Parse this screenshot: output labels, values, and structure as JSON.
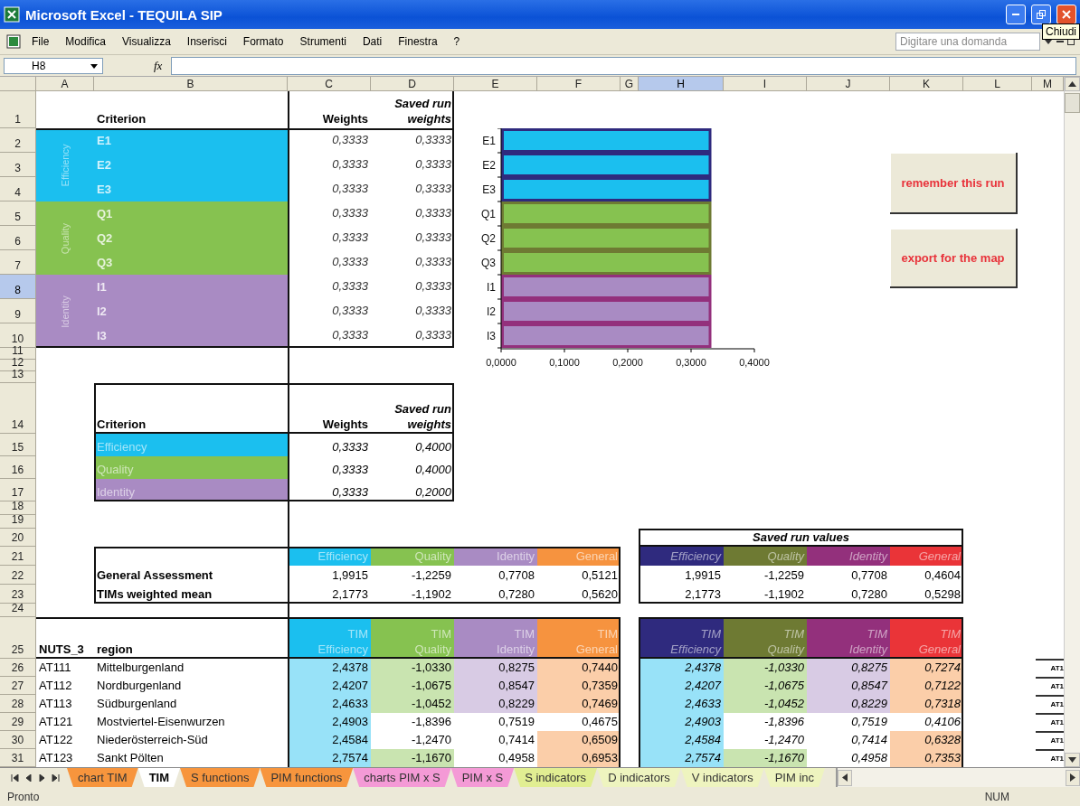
{
  "window": {
    "title": "Microsoft Excel - TEQUILA SIP",
    "tooltip": "Chiudi"
  },
  "menu": {
    "items": [
      "File",
      "Modifica",
      "Visualizza",
      "Inserisci",
      "Formato",
      "Strumenti",
      "Dati",
      "Finestra",
      "?"
    ],
    "help_placeholder": "Digitare una domanda"
  },
  "formula_bar": {
    "name_box": "H8",
    "function_label": "fx"
  },
  "columns": [
    {
      "label": "A",
      "selected": false
    },
    {
      "label": "B",
      "selected": false
    },
    {
      "label": "C",
      "selected": false
    },
    {
      "label": "D",
      "selected": false
    },
    {
      "label": "E",
      "selected": false
    },
    {
      "label": "F",
      "selected": false
    },
    {
      "label": "G",
      "selected": false
    },
    {
      "label": "H",
      "selected": true
    },
    {
      "label": "I",
      "selected": false
    },
    {
      "label": "J",
      "selected": false
    },
    {
      "label": "K",
      "selected": false
    },
    {
      "label": "L",
      "selected": false
    },
    {
      "label": "M",
      "selected": false
    }
  ],
  "rows": [
    {
      "label": "1",
      "selected": false
    },
    {
      "label": "2",
      "selected": false
    },
    {
      "label": "3",
      "selected": false
    },
    {
      "label": "4",
      "selected": false
    },
    {
      "label": "5",
      "selected": false
    },
    {
      "label": "6",
      "selected": false
    },
    {
      "label": "7",
      "selected": false
    },
    {
      "label": "8",
      "selected": true
    },
    {
      "label": "9",
      "selected": false
    },
    {
      "label": "10",
      "selected": false
    },
    {
      "label": "11",
      "selected": false
    },
    {
      "label": "12",
      "selected": false
    },
    {
      "label": "13",
      "selected": false
    },
    {
      "label": "14",
      "selected": false
    },
    {
      "label": "15",
      "selected": false
    },
    {
      "label": "16",
      "selected": false
    },
    {
      "label": "17",
      "selected": false
    },
    {
      "label": "18",
      "selected": false
    },
    {
      "label": "19",
      "selected": false
    },
    {
      "label": "20",
      "selected": false
    },
    {
      "label": "21",
      "selected": false
    },
    {
      "label": "22",
      "selected": false
    },
    {
      "label": "23",
      "selected": false
    },
    {
      "label": "24",
      "selected": false
    },
    {
      "label": "25",
      "selected": false
    },
    {
      "label": "26",
      "selected": false
    },
    {
      "label": "27",
      "selected": false
    },
    {
      "label": "28",
      "selected": false
    },
    {
      "label": "29",
      "selected": false
    },
    {
      "label": "30",
      "selected": false
    },
    {
      "label": "31",
      "selected": false
    }
  ],
  "criteria_table": {
    "headers": {
      "criterion": "Criterion",
      "weights": "Weights",
      "saved": "Saved run weights"
    },
    "groups": [
      {
        "name": "Efficiency",
        "color": "#1bbfef",
        "items": [
          {
            "label": "E1",
            "weight": "0,3333",
            "saved": "0,3333"
          },
          {
            "label": "E2",
            "weight": "0,3333",
            "saved": "0,3333"
          },
          {
            "label": "E3",
            "weight": "0,3333",
            "saved": "0,3333"
          }
        ]
      },
      {
        "name": "Quality",
        "color": "#86c250",
        "items": [
          {
            "label": "Q1",
            "weight": "0,3333",
            "saved": "0,3333"
          },
          {
            "label": "Q2",
            "weight": "0,3333",
            "saved": "0,3333"
          },
          {
            "label": "Q3",
            "weight": "0,3333",
            "saved": "0,3333"
          }
        ]
      },
      {
        "name": "Identity",
        "color": "#a98bc3",
        "items": [
          {
            "label": "I1",
            "weight": "0,3333",
            "saved": "0,3333"
          },
          {
            "label": "I2",
            "weight": "0,3333",
            "saved": "0,3333"
          },
          {
            "label": "I3",
            "weight": "0,3333",
            "saved": "0,3333"
          }
        ]
      }
    ]
  },
  "chart_data": {
    "type": "bar",
    "orientation": "horizontal",
    "categories": [
      "E1",
      "E2",
      "E3",
      "Q1",
      "Q2",
      "Q3",
      "I1",
      "I2",
      "I3"
    ],
    "values": [
      0.33,
      0.33,
      0.33,
      0.33,
      0.33,
      0.33,
      0.33,
      0.33,
      0.33
    ],
    "xlim": [
      0,
      0.4
    ],
    "xticks": [
      {
        "value": 0,
        "label": "0,0000"
      },
      {
        "value": 0.1,
        "label": "0,1000"
      },
      {
        "value": 0.2,
        "label": "0,2000"
      },
      {
        "value": 0.3,
        "label": "0,3000"
      },
      {
        "value": 0.4,
        "label": "0,4000"
      }
    ]
  },
  "buttons": [
    "remember this run",
    "export for the map"
  ],
  "summary_table": {
    "headers": {
      "criterion": "Criterion",
      "weights": "Weights",
      "saved": "Saved run weights"
    },
    "items": [
      {
        "label": "Efficiency",
        "color": "#1bbfef",
        "weight": "0,3333",
        "saved": "0,4000"
      },
      {
        "label": "Quality",
        "color": "#86c250",
        "weight": "0,3333",
        "saved": "0,4000"
      },
      {
        "label": "Identity",
        "color": "#a98bc3",
        "weight": "0,3333",
        "saved": "0,2000"
      }
    ]
  },
  "assessment": {
    "columns": [
      {
        "label": "Efficiency",
        "color": "#1bbfef"
      },
      {
        "label": "Quality",
        "color": "#86c250"
      },
      {
        "label": "Identity",
        "color": "#a98bc3"
      },
      {
        "label": "General",
        "color": "#f6933f"
      }
    ],
    "rows": [
      {
        "label": "General Assessment",
        "values": [
          "1,9915",
          "-1,2259",
          "0,7708",
          "0,5121"
        ]
      },
      {
        "label": "TIMs weighted mean",
        "values": [
          "2,1773",
          "-1,1902",
          "0,7280",
          "0,5620"
        ]
      }
    ]
  },
  "saved_values": {
    "title": "Saved run values",
    "columns": [
      {
        "label": "Efficiency",
        "color": "#2f2a7e"
      },
      {
        "label": "Quality",
        "color": "#6e7a33"
      },
      {
        "label": "Identity",
        "color": "#93307c"
      },
      {
        "label": "General",
        "color": "#ea3438"
      }
    ],
    "rows": [
      [
        "1,9915",
        "-1,2259",
        "0,7708",
        "0,4604"
      ],
      [
        "2,1773",
        "-1,1902",
        "0,7280",
        "0,5298"
      ]
    ]
  },
  "regions": {
    "code_header": "NUTS_3",
    "name_header": "region",
    "columns": [
      {
        "top": "TIM",
        "bottom": "Efficiency",
        "color": "#1bbfef"
      },
      {
        "top": "TIM",
        "bottom": "Quality",
        "color": "#86c250"
      },
      {
        "top": "TIM",
        "bottom": "Identity",
        "color": "#a98bc3"
      },
      {
        "top": "TIM",
        "bottom": "General",
        "color": "#f6933f"
      }
    ],
    "saved_columns": [
      {
        "top": "TIM",
        "bottom": "Efficiency",
        "color": "#2f2a7e"
      },
      {
        "top": "TIM",
        "bottom": "Quality",
        "color": "#6e7a33"
      },
      {
        "top": "TIM",
        "bottom": "Identity",
        "color": "#93307c"
      },
      {
        "top": "TIM",
        "bottom": "General",
        "color": "#ea3438"
      }
    ],
    "rows": [
      {
        "code": "AT111",
        "name": "Mittelburgenland",
        "values": [
          {
            "text": "2,4378",
            "shaded": true
          },
          {
            "text": "-1,0330",
            "shaded": true
          },
          {
            "text": "0,8275",
            "shaded": true
          },
          {
            "text": "0,7440",
            "shaded": true
          }
        ],
        "saved": [
          {
            "text": "2,4378",
            "shaded": true
          },
          {
            "text": "-1,0330",
            "shaded": true
          },
          {
            "text": "0,8275",
            "shaded": true
          },
          {
            "text": "0,7274",
            "shaded": true
          }
        ]
      },
      {
        "code": "AT112",
        "name": "Nordburgenland",
        "values": [
          {
            "text": "2,4207",
            "shaded": true
          },
          {
            "text": "-1,0675",
            "shaded": true
          },
          {
            "text": "0,8547",
            "shaded": true
          },
          {
            "text": "0,7359",
            "shaded": true
          }
        ],
        "saved": [
          {
            "text": "2,4207",
            "shaded": true
          },
          {
            "text": "-1,0675",
            "shaded": true
          },
          {
            "text": "0,8547",
            "shaded": true
          },
          {
            "text": "0,7122",
            "shaded": true
          }
        ]
      },
      {
        "code": "AT113",
        "name": "Südburgenland",
        "values": [
          {
            "text": "2,4633",
            "shaded": true
          },
          {
            "text": "-1,0452",
            "shaded": true
          },
          {
            "text": "0,8229",
            "shaded": true
          },
          {
            "text": "0,7469",
            "shaded": true
          }
        ],
        "saved": [
          {
            "text": "2,4633",
            "shaded": true
          },
          {
            "text": "-1,0452",
            "shaded": true
          },
          {
            "text": "0,8229",
            "shaded": true
          },
          {
            "text": "0,7318",
            "shaded": true
          }
        ]
      },
      {
        "code": "AT121",
        "name": "Mostviertel-Eisenwurzen",
        "values": [
          {
            "text": "2,4903",
            "shaded": true
          },
          {
            "text": "-1,8396",
            "shaded": false
          },
          {
            "text": "0,7519",
            "shaded": false
          },
          {
            "text": "0,4675",
            "shaded": false
          }
        ],
        "saved": [
          {
            "text": "2,4903",
            "shaded": true
          },
          {
            "text": "-1,8396",
            "shaded": false
          },
          {
            "text": "0,7519",
            "shaded": false
          },
          {
            "text": "0,4106",
            "shaded": false
          }
        ]
      },
      {
        "code": "AT122",
        "name": "Niederösterreich-Süd",
        "values": [
          {
            "text": "2,4584",
            "shaded": true
          },
          {
            "text": "-1,2470",
            "shaded": false
          },
          {
            "text": "0,7414",
            "shaded": false
          },
          {
            "text": "0,6509",
            "shaded": true
          }
        ],
        "saved": [
          {
            "text": "2,4584",
            "shaded": true
          },
          {
            "text": "-1,2470",
            "shaded": false
          },
          {
            "text": "0,7414",
            "shaded": false
          },
          {
            "text": "0,6328",
            "shaded": true
          }
        ]
      },
      {
        "code": "AT123",
        "name": "Sankt Pölten",
        "values": [
          {
            "text": "2,7574",
            "shaded": true
          },
          {
            "text": "-1,1670",
            "shaded": true
          },
          {
            "text": "0,4958",
            "shaded": false
          },
          {
            "text": "0,6953",
            "shaded": true
          }
        ],
        "saved": [
          {
            "text": "2,7574",
            "shaded": true
          },
          {
            "text": "-1,1670",
            "shaded": true
          },
          {
            "text": "0,4958",
            "shaded": false
          },
          {
            "text": "0,7353",
            "shaded": true
          }
        ]
      }
    ]
  },
  "side_labels": [
    "AT1",
    "AT1",
    "AT1",
    "AT1",
    "AT1",
    "AT1"
  ],
  "sheet_tabs": [
    {
      "label": "chart TIM",
      "selected": false,
      "color": "#f7953d"
    },
    {
      "label": "TIM",
      "selected": true
    },
    {
      "label": "S functions",
      "selected": false,
      "color": "#f7953d"
    },
    {
      "label": "PIM functions",
      "selected": false,
      "color": "#f7953d"
    },
    {
      "label": "charts PIM x S",
      "selected": false,
      "color": "#f49ad6"
    },
    {
      "label": "PIM x S",
      "selected": false,
      "color": "#f49ad6"
    },
    {
      "label": "S indicators",
      "selected": false,
      "color": "#e1ee92"
    },
    {
      "label": "D indicators",
      "selected": false,
      "color": "#eef4bf"
    },
    {
      "label": "V indicators",
      "selected": false,
      "color": "#eef4bf"
    },
    {
      "label": "PIM inc",
      "selected": false,
      "color": "#eef4bf"
    }
  ],
  "status_bar": {
    "left": "Pronto",
    "right": "NUM"
  }
}
